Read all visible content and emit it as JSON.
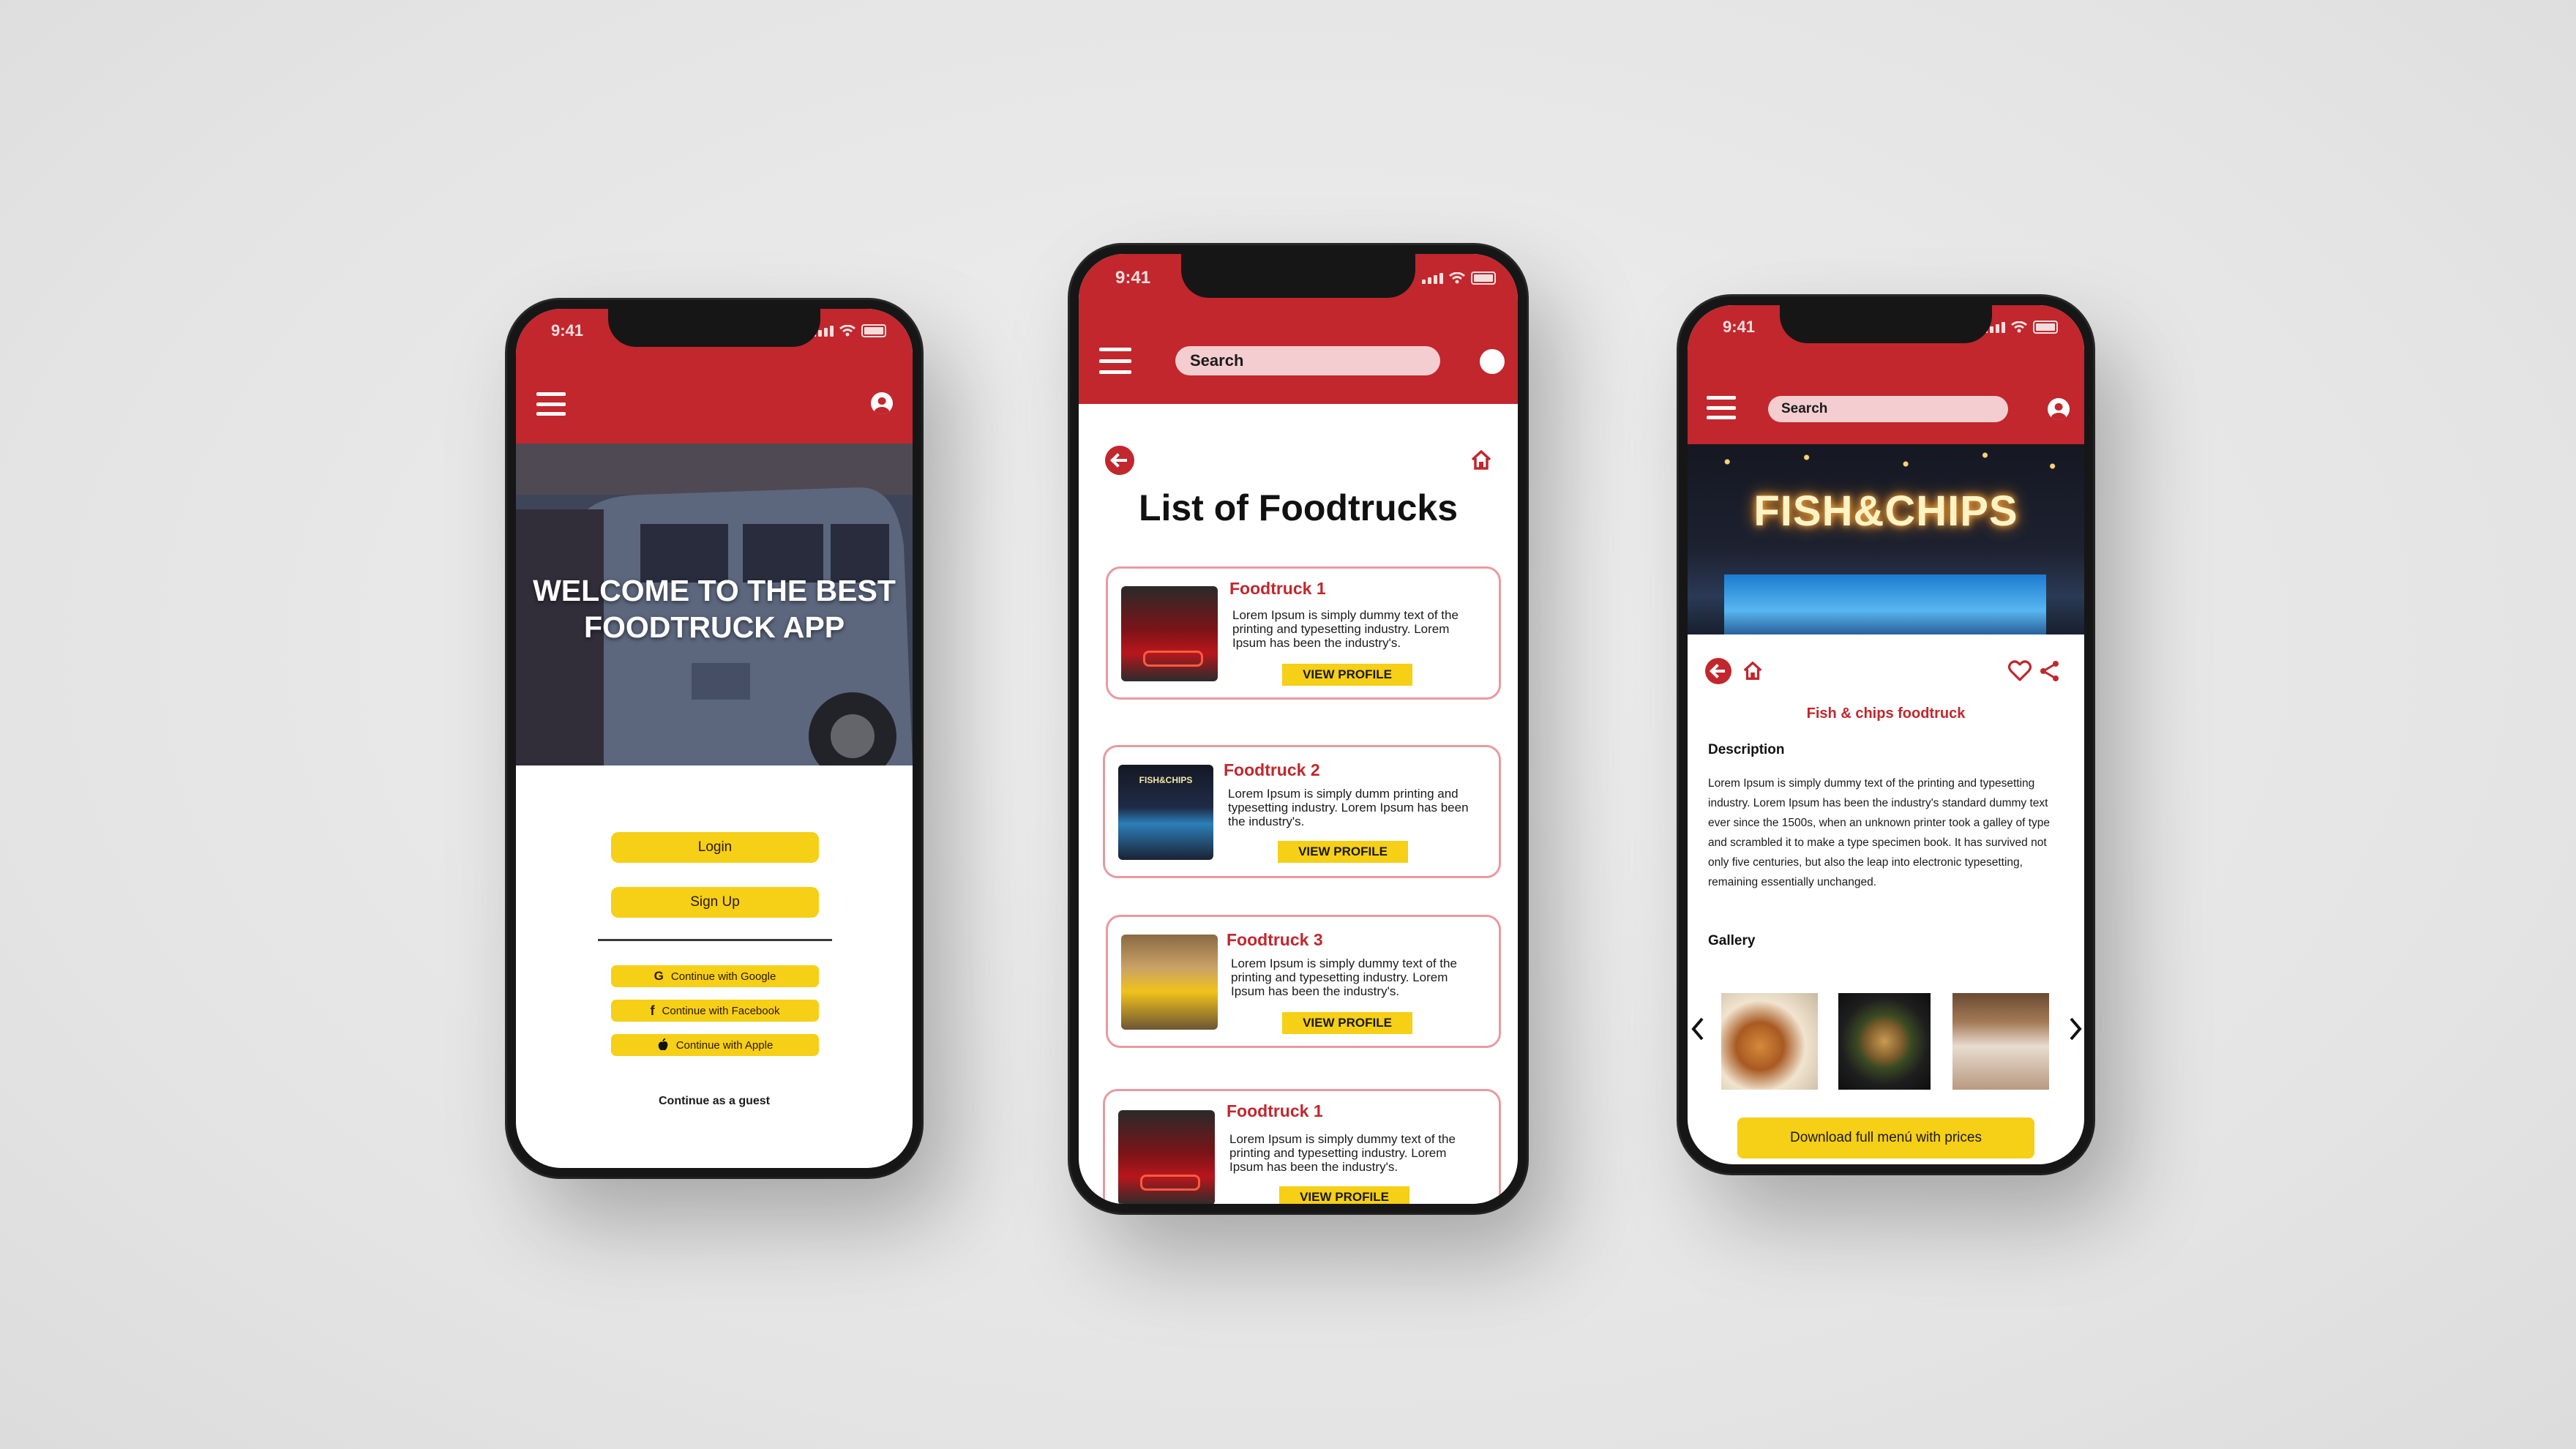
{
  "status_time": "9:41",
  "colors": {
    "brand_red": "#c1272d",
    "accent_yellow": "#f6cf17",
    "search_pink": "#f3cdd0",
    "card_border": "#e89aa0"
  },
  "icons": {
    "menu": "hamburger-menu-icon",
    "user": "user-circle-icon",
    "back": "back-arrow-icon",
    "home": "home-icon",
    "heart": "heart-icon",
    "share": "share-icon",
    "google": "google-icon",
    "facebook": "facebook-icon",
    "apple": "apple-icon"
  },
  "screen1": {
    "hero_line1": "WELCOME TO THE BEST",
    "hero_line2": "FOODTRUCK APP",
    "login_label": "Login",
    "signup_label": "Sign Up",
    "google_label": "Continue with Google",
    "facebook_label": "Continue with Facebook",
    "apple_label": "Continue with Apple",
    "guest_label": "Continue as a guest"
  },
  "screen2": {
    "search_placeholder": "Search",
    "page_title": "List of Foodtrucks",
    "items": [
      {
        "title": "Foodtruck 1",
        "desc": "Lorem Ipsum is simply dummy text of the printing and typesetting industry. Lorem Ipsum has been the industry's.",
        "button": "VIEW PROFILE"
      },
      {
        "title": "Foodtruck 2",
        "desc": "Lorem Ipsum is simply dumm printing and typesetting industry. Lorem Ipsum has been the industry's.",
        "button": "VIEW PROFILE"
      },
      {
        "title": "Foodtruck 3",
        "desc": "Lorem Ipsum is simply dummy text of the printing and typesetting industry. Lorem Ipsum has been the industry's.",
        "button": "VIEW PROFILE"
      },
      {
        "title": "Foodtruck 1",
        "desc": "Lorem Ipsum is simply dummy text of the printing and typesetting industry. Lorem Ipsum has been the industry's.",
        "button": "VIEW PROFILE"
      }
    ]
  },
  "screen3": {
    "search_placeholder": "Search",
    "hero_sign": "FISH&CHIPS",
    "truck_name": "Fish & chips foodtruck",
    "description_heading": "Description",
    "description_text": "Lorem Ipsum is simply dummy text of the printing and typesetting industry. Lorem Ipsum has been the industry's standard dummy text ever since the 1500s, when an unknown printer took a galley of type and scrambled it to make a type specimen book. It has survived not only five centuries, but also the leap into electronic typesetting, remaining essentially unchanged.",
    "gallery_heading": "Gallery",
    "download_label": "Download full menú with prices"
  }
}
